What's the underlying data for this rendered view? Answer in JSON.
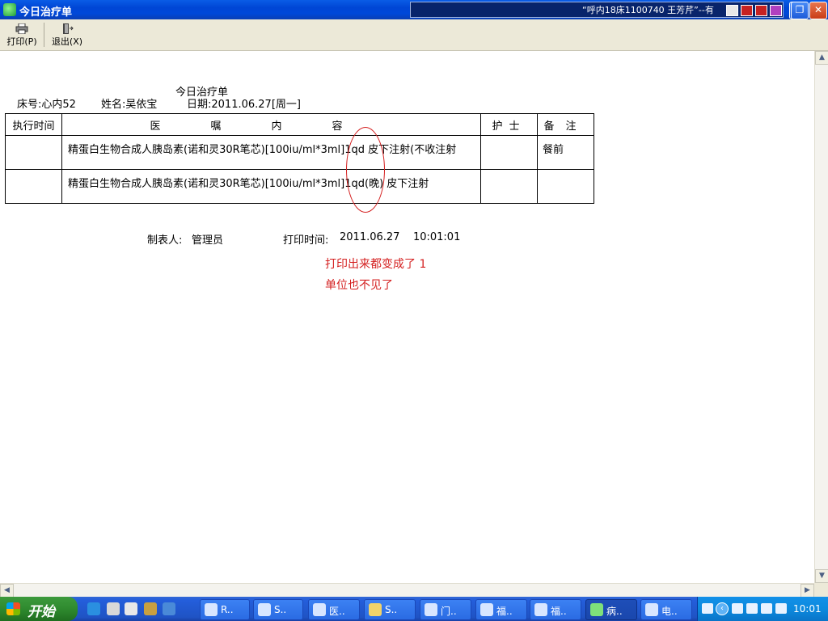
{
  "window": {
    "title": "今日治疗单",
    "im_notification": "“呼内18床1100740 王芳芹”--有"
  },
  "toolbar": {
    "print_label": "打印(P)",
    "exit_label": "退出(X)"
  },
  "document": {
    "title": "今日治疗单",
    "bed_no": "床号:心内52",
    "patient_name": "姓名:吴依宝",
    "date": "日期:2011.06.27[周一]",
    "table": {
      "headers": {
        "time": "执行时间",
        "order": "医嘱内容",
        "nurse": "护士",
        "note": "备注"
      },
      "rows": [
        {
          "time": "",
          "order": "精蛋白生物合成人胰岛素(诺和灵30R笔芯)[100iu/ml*3ml]1qd 皮下注射(不收注射",
          "nurse": "",
          "note": "餐前"
        },
        {
          "time": "",
          "order": "精蛋白生物合成人胰岛素(诺和灵30R笔芯)[100iu/ml*3ml]1qd(晚) 皮下注射",
          "nurse": "",
          "note": ""
        }
      ]
    },
    "maker_label": "制表人:",
    "maker_value": "管理员",
    "print_time_label": "打印时间:",
    "print_time_value": "2011.06.27    10:01:01",
    "annotation_line1": "打印出来都变成了 1",
    "annotation_line2": "单位也不见了",
    "annotation_color": "#d42020"
  },
  "taskbar": {
    "start_label": "开始",
    "tasks": [
      {
        "label": "R..",
        "icon": "document-icon"
      },
      {
        "label": "S..",
        "icon": "gear-icon"
      },
      {
        "label": "医..",
        "icon": "app-icon"
      },
      {
        "label": "S..",
        "icon": "folder-icon"
      },
      {
        "label": "门..",
        "icon": "window-icon"
      },
      {
        "label": "福..",
        "icon": "ie-icon"
      },
      {
        "label": "福..",
        "icon": "ie-icon"
      },
      {
        "label": "病..",
        "icon": "app-icon"
      },
      {
        "label": "电..",
        "icon": "person-icon"
      }
    ],
    "clock": "10:01"
  }
}
